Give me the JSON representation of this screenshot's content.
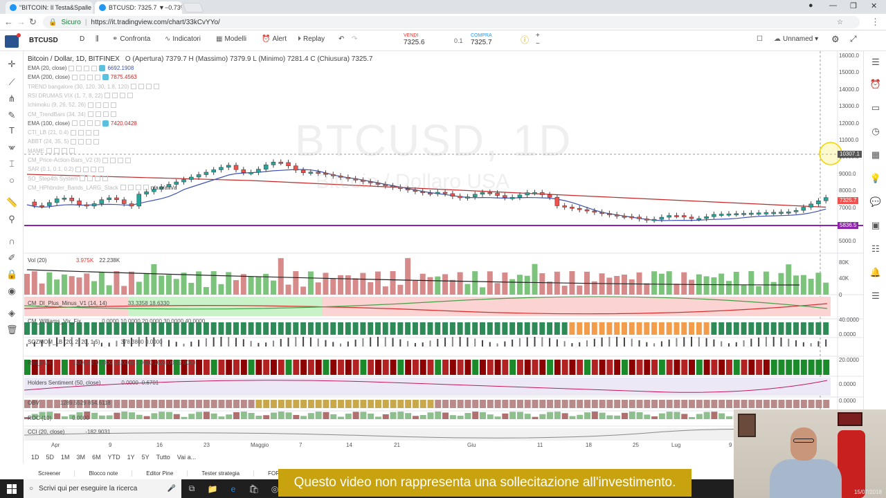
{
  "browser": {
    "tabs": [
      {
        "title": "\"BITCOIN: Il Testa&Spalle"
      },
      {
        "title": "BTCUSD: 7325.7 ▼−0.73%"
      }
    ],
    "url_secure": "Sicuro",
    "url": "https://it.tradingview.com/chart/33kCvYYo/"
  },
  "toolbar": {
    "symbol": "BTCUSD",
    "interval": "D",
    "compare": "Confronta",
    "indicators": "Indicatori",
    "templates": "Modelli",
    "alert": "Alert",
    "replay": "Replay",
    "sell_label": "VENDI",
    "sell_value": "7325.6",
    "spread": "0.1",
    "buy_label": "COMPRA",
    "buy_value": "7325.7",
    "layout_name": "Unnamed"
  },
  "legend": {
    "title": "Bitcoin / Dollar, 1D, BITFINEX",
    "ohlc": "O (Apertura) 7379.7  H (Massimo) 7379.9  L (Minimo) 7281.4  C (Chiusura) 7325.7",
    "indicators": [
      {
        "name": "EMA (20, close)",
        "value": "6692.1908",
        "faded": false
      },
      {
        "name": "EMA (200, close)",
        "value": "7875.4563",
        "faded": false
      },
      {
        "name": "TREND bangalore (30, 120, 30, 1.8, 120)",
        "value": "",
        "faded": true
      },
      {
        "name": "RSI DRUMAS VIX (1, 7, 8, 22)",
        "value": "",
        "faded": true
      },
      {
        "name": "Ichimoku (9, 26, 52, 26)",
        "value": "",
        "faded": true
      },
      {
        "name": "CM_TrendBars (34, 34)",
        "value": "",
        "faded": true
      },
      {
        "name": "EMA (100, close)",
        "value": "7420.0428",
        "faded": false
      },
      {
        "name": "CTI_LB (21, 0.4)",
        "value": "",
        "faded": true
      },
      {
        "name": "ABBT (24, 35, 5)",
        "value": "",
        "faded": true
      },
      {
        "name": "MAME",
        "value": "",
        "faded": true
      },
      {
        "name": "CM_Price-Action-Bars_V2 (3)",
        "value": "",
        "faded": true
      },
      {
        "name": "SAR (0.1, 0.1, 0.2)",
        "value": "",
        "faded": true
      },
      {
        "name": "SO_Step4th System",
        "value": "",
        "faded": true
      },
      {
        "name": "CM_HPhbnder_Bands_LARG_Stack",
        "value": "n/a n/a n/a",
        "faded": true
      }
    ]
  },
  "watermark": {
    "symbol": "BTCUSD, 1D",
    "subtitle": "Bitcoin / Dollaro USA"
  },
  "price_axis": [
    "16000.0",
    "15000.0",
    "14000.0",
    "13000.0",
    "12000.0",
    "11000.0",
    "10000.0",
    "9000.0",
    "8000.0",
    "7000.0",
    "6000.0",
    "5000.0"
  ],
  "price_tags": {
    "crosshair": "10307.1",
    "last": "7325.7",
    "line": "5836.5"
  },
  "volume_pane": {
    "label": "Vol (20)",
    "value1": "3.975K",
    "value2": "22.238K",
    "axis": [
      "80K",
      "40K",
      "0"
    ]
  },
  "panes": [
    {
      "label": "CM_DI_Plus_Minus_V1 (14, 14)",
      "values": "33.3358  18.6330"
    },
    {
      "label": "CM_Williams_Vix_Fix",
      "values": "0.0000  10.0000  20.0000  30.0000  40.0000"
    },
    {
      "label": "SQZMOM_LB (20, 2, 20, 1.5)",
      "values": "378.3800  0.0000"
    },
    {
      "label": "RSI_Multi",
      "values": "1.0000  2  9.0000  10.0000  1.0000  16.0000  19.0000"
    },
    {
      "label": "Holders Sentiment (50, close)",
      "values": "0.0000  -0.6701"
    },
    {
      "label": "OBV",
      "values": "1289.5529  854.6118"
    },
    {
      "label": "ROC (10)",
      "values": "0.0000"
    },
    {
      "label": "CCI (20, close)",
      "values": "-182.9031"
    }
  ],
  "pane_axis": [
    "40.0000",
    "0.0000",
    "20.0000",
    "0.0000",
    "0.0000",
    "0.0000"
  ],
  "dates": [
    "Apr",
    "9",
    "16",
    "23",
    "Maggio",
    "7",
    "14",
    "21",
    "Giu",
    "11",
    "18",
    "25",
    "Lug",
    "9"
  ],
  "ranges": [
    "1D",
    "5D",
    "1M",
    "3M",
    "6M",
    "YTD",
    "1Y",
    "5Y",
    "Tutto",
    "Vai a..."
  ],
  "bottom_tabs": [
    "Screener",
    "Blocco note",
    "Editor Pine",
    "Tester strategia",
    "FOREX.com"
  ],
  "caption": "Questo video non rappresenta una sollecitazione all'investimento.",
  "taskbar": {
    "search_placeholder": "Scrivi qui per eseguire la ricerca"
  },
  "webcam": {
    "date": "15/07/2018"
  },
  "colors": {
    "up": "#26a69a",
    "down": "#ef5350",
    "ema20": "#3f51b5",
    "ema200": "#c62828",
    "support": "#8e24aa",
    "caption_bg": "#c9a20f"
  }
}
